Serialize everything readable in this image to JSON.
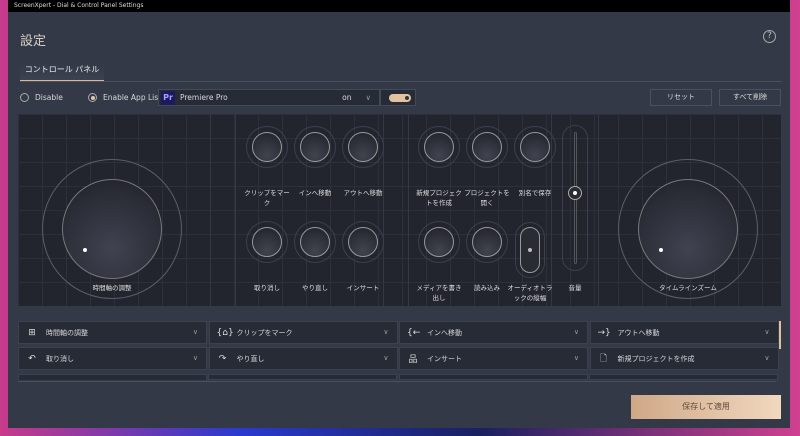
{
  "window_title": "ScreenXpert - Dial & Control Panel Settings",
  "title": "設定",
  "tab": "コントロール パネル",
  "disable_label": "Disable",
  "enable_label": "Enable App List",
  "app": {
    "icon": "Pr",
    "name": "Premiere Pro",
    "state": "on"
  },
  "reset_label": "リセット",
  "delete_all_label": "すべて削除",
  "left_dial_label": "時間軸の調整",
  "right_dial_label": "タイムラインズーム",
  "keys": [
    "クリップをマーク",
    "インへ移動",
    "アウトへ移動",
    "取り消し",
    "やり直し",
    "インサート",
    "新規プロジェクトを作成",
    "プロジェクトを開く",
    "別名で保存",
    "メディアを書き出し",
    "読み込み"
  ],
  "rocker_label": "オーディオトラックの縦幅",
  "slider_label": "音量",
  "assignments": [
    {
      "icon": "timeline-icon",
      "glyph": "⊞",
      "label": "時間軸の調整"
    },
    {
      "icon": "mark-icon",
      "glyph": "{⌂}",
      "label": "クリップをマーク"
    },
    {
      "icon": "go-in-icon",
      "glyph": "{←",
      "label": "インへ移動"
    },
    {
      "icon": "go-out-icon",
      "glyph": "→}",
      "label": "アウトへ移動"
    },
    {
      "icon": "undo-icon",
      "glyph": "↶",
      "label": "取り消し"
    },
    {
      "icon": "redo-icon",
      "glyph": "↷",
      "label": "やり直し"
    },
    {
      "icon": "insert-icon",
      "glyph": "品",
      "label": "インサート"
    },
    {
      "icon": "new-file-icon",
      "glyph": "🗋",
      "label": "新規プロジェクトを作成"
    }
  ],
  "save_label": "保存して適用"
}
